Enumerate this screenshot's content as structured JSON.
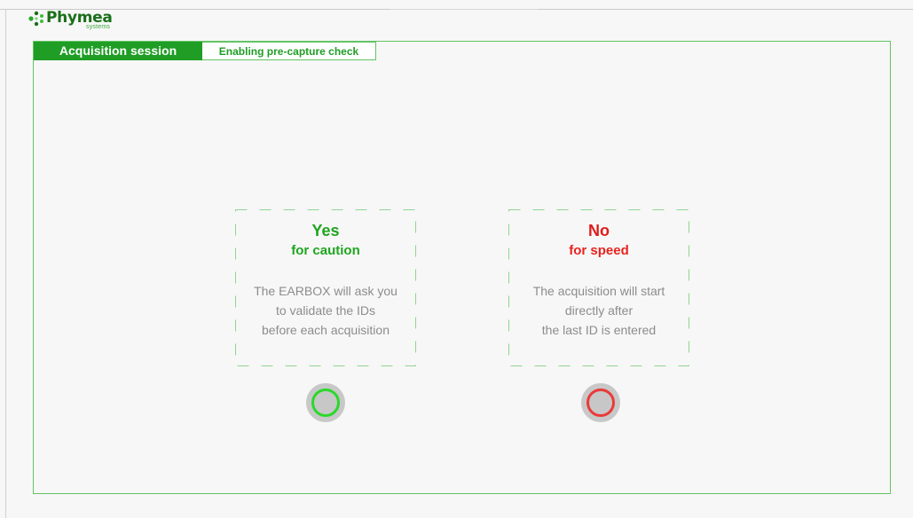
{
  "logo": {
    "name": "Phymea",
    "subtitle": "systems",
    "icon": "molecule-icon"
  },
  "session": {
    "title": "Acquisition session",
    "subtitle": "Enabling pre-capture check"
  },
  "options": [
    {
      "title": "Yes",
      "subtitle": "for caution",
      "description": [
        "The EARBOX will ask you",
        "to validate the IDs",
        "before each acquisition"
      ],
      "button_icon": "green-ring-icon",
      "color": "#1fa51f"
    },
    {
      "title": "No",
      "subtitle": "for speed",
      "description": [
        "The acquisition will start",
        "directly after",
        "the last ID is entered"
      ],
      "button_icon": "red-ring-icon",
      "color": "#e01b1b"
    }
  ],
  "colors": {
    "accent": "#1f9d25",
    "frame": "#63c463",
    "background": "#f7f7f7"
  }
}
